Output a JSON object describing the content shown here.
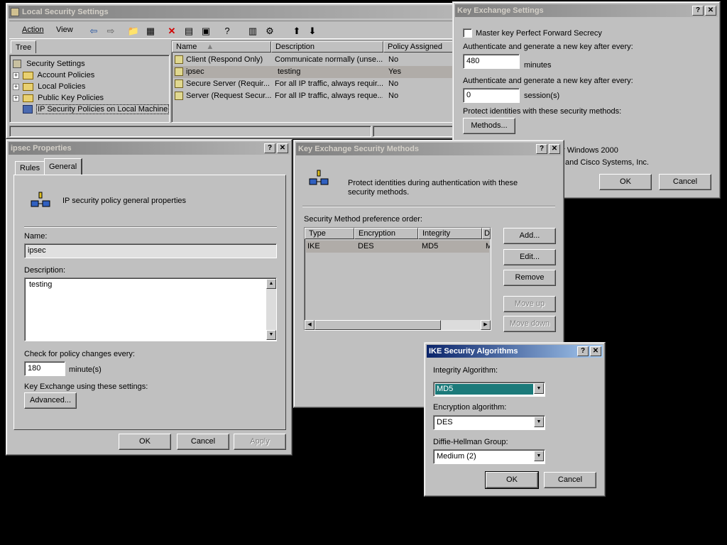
{
  "main": {
    "title": "Local Security Settings",
    "menu": {
      "action": "Action",
      "view": "View"
    },
    "tree_tab": "Tree",
    "tree": [
      "Security Settings",
      "Account Policies",
      "Local Policies",
      "Public Key Policies",
      "IP Security Policies on Local Machine"
    ],
    "columns": {
      "name": "Name",
      "description": "Description",
      "assigned": "Policy Assigned"
    },
    "rows": [
      {
        "name": "Client (Respond Only)",
        "description": "Communicate normally (unse...",
        "assigned": "No"
      },
      {
        "name": "ipsec",
        "description": "testing",
        "assigned": "Yes"
      },
      {
        "name": "Secure Server (Requir...",
        "description": "For all IP traffic, always requir...",
        "assigned": "No"
      },
      {
        "name": "Server (Request Secur...",
        "description": "For all IP traffic, always reque...",
        "assigned": "No"
      }
    ]
  },
  "ipsec_props": {
    "title": "ipsec Properties",
    "tabs": {
      "rules": "Rules",
      "general": "General"
    },
    "heading": "IP security policy general properties",
    "name_label": "Name:",
    "name_value": "ipsec",
    "desc_label": "Description:",
    "desc_value": "testing",
    "check_label": "Check for policy changes every:",
    "check_value": "180",
    "check_unit": "minute(s)",
    "keyx_label": "Key Exchange using these settings:",
    "advanced": "Advanced...",
    "ok": "OK",
    "cancel": "Cancel",
    "apply": "Apply"
  },
  "kx_settings": {
    "title": "Key Exchange Settings",
    "pfs": "Master key Perfect Forward Secrecy",
    "auth1_label": "Authenticate and generate a new key after every:",
    "auth1_value": "480",
    "auth1_unit": "minutes",
    "auth2_label": "Authenticate and generate a new key after every:",
    "auth2_value": "0",
    "auth2_unit": "session(s)",
    "protect_label": "Protect identities with these security methods:",
    "methods": "Methods...",
    "partial1": "r Windows 2000",
    "partial2": "and Cisco Systems, Inc.",
    "ok": "OK",
    "cancel": "Cancel"
  },
  "kx_methods": {
    "title": "Key Exchange Security Methods",
    "intro": "Protect identities during authentication with these security methods.",
    "pref_label": "Security Method preference order:",
    "columns": {
      "type": "Type",
      "encryption": "Encryption",
      "integrity": "Integrity",
      "d": "D"
    },
    "rows": [
      {
        "type": "IKE",
        "encryption": "DES",
        "integrity": "MD5",
        "d": "M"
      }
    ],
    "add": "Add...",
    "edit": "Edit...",
    "remove": "Remove",
    "move_up": "Move up",
    "move_down": "Move down"
  },
  "ike_algos": {
    "title": "IKE Security Algorithms",
    "integrity_label": "Integrity Algorithm:",
    "integrity_value": "MD5",
    "encryption_label": "Encryption algorithm:",
    "encryption_value": "DES",
    "dh_label": "Diffie-Hellman Group:",
    "dh_value": "Medium (2)",
    "ok": "OK",
    "cancel": "Cancel"
  },
  "colors": {
    "highlight": "#1b7a7a",
    "desktop": "#000000",
    "face": "#c0c0c0"
  }
}
